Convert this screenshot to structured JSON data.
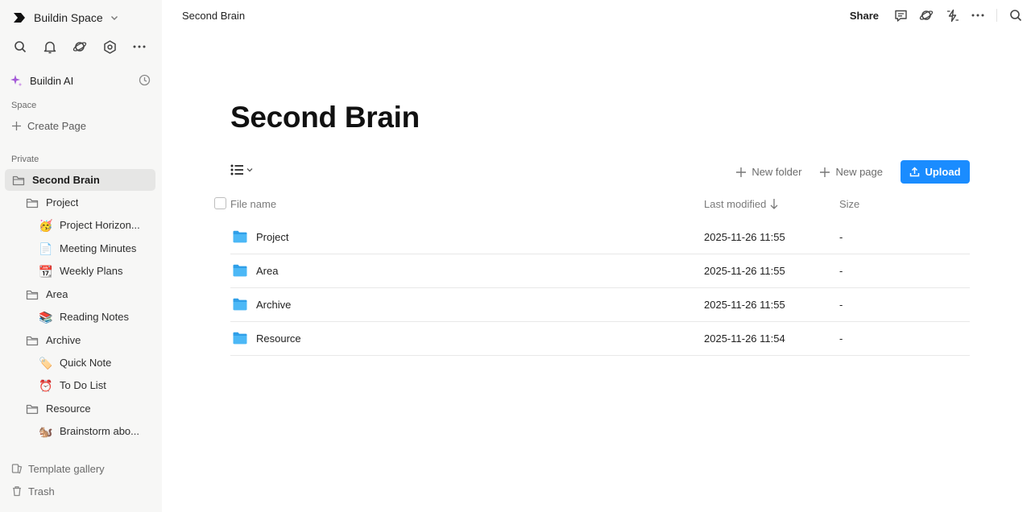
{
  "workspace": {
    "name": "Buildin Space"
  },
  "ai": {
    "label": "Buildin AI"
  },
  "sidebar": {
    "space_label": "Space",
    "create_page": "Create Page",
    "private_label": "Private",
    "tree": [
      {
        "label": "Second Brain",
        "icon": "folder-icon",
        "level": 0,
        "active": true
      },
      {
        "label": "Project",
        "icon": "folder-icon",
        "level": 1
      },
      {
        "label": "Project Horizon...",
        "icon": "party-face-emoji",
        "emoji": "🥳",
        "level": 2
      },
      {
        "label": "Meeting Minutes",
        "icon": "document-emoji",
        "emoji": "📄",
        "level": 2
      },
      {
        "label": "Weekly Plans",
        "icon": "calendar-emoji",
        "emoji": "📆",
        "level": 2
      },
      {
        "label": "Area",
        "icon": "folder-icon",
        "level": 1
      },
      {
        "label": "Reading Notes",
        "icon": "books-emoji",
        "emoji": "📚",
        "level": 2
      },
      {
        "label": "Archive",
        "icon": "folder-icon",
        "level": 1
      },
      {
        "label": "Quick Note",
        "icon": "memo-emoji",
        "emoji": "🏷️",
        "level": 2
      },
      {
        "label": "To Do List",
        "icon": "alarm-clock-emoji",
        "emoji": "⏰",
        "level": 2
      },
      {
        "label": "Resource",
        "icon": "folder-icon",
        "level": 1
      },
      {
        "label": "Brainstorm abo...",
        "icon": "squirrel-emoji",
        "emoji": "🐿️",
        "level": 2
      }
    ],
    "template_gallery": "Template gallery",
    "trash": "Trash"
  },
  "topbar": {
    "breadcrumb": "Second Brain",
    "share": "Share"
  },
  "page": {
    "title": "Second Brain",
    "new_folder": "New folder",
    "new_page": "New page",
    "upload": "Upload",
    "columns": {
      "name": "File name",
      "modified": "Last modified",
      "size": "Size"
    },
    "files": [
      {
        "name": "Project",
        "modified": "2025-11-26 11:55",
        "size": "-"
      },
      {
        "name": "Area",
        "modified": "2025-11-26 11:55",
        "size": "-"
      },
      {
        "name": "Archive",
        "modified": "2025-11-26 11:55",
        "size": "-"
      },
      {
        "name": "Resource",
        "modified": "2025-11-26 11:54",
        "size": "-"
      }
    ]
  },
  "colors": {
    "sidebar_bg": "#f7f7f6",
    "active_item_bg": "#e6e6e5",
    "accent": "#1a8cff",
    "folder_blue": "#35a9f2",
    "ai_purple": "#a45ad8"
  }
}
